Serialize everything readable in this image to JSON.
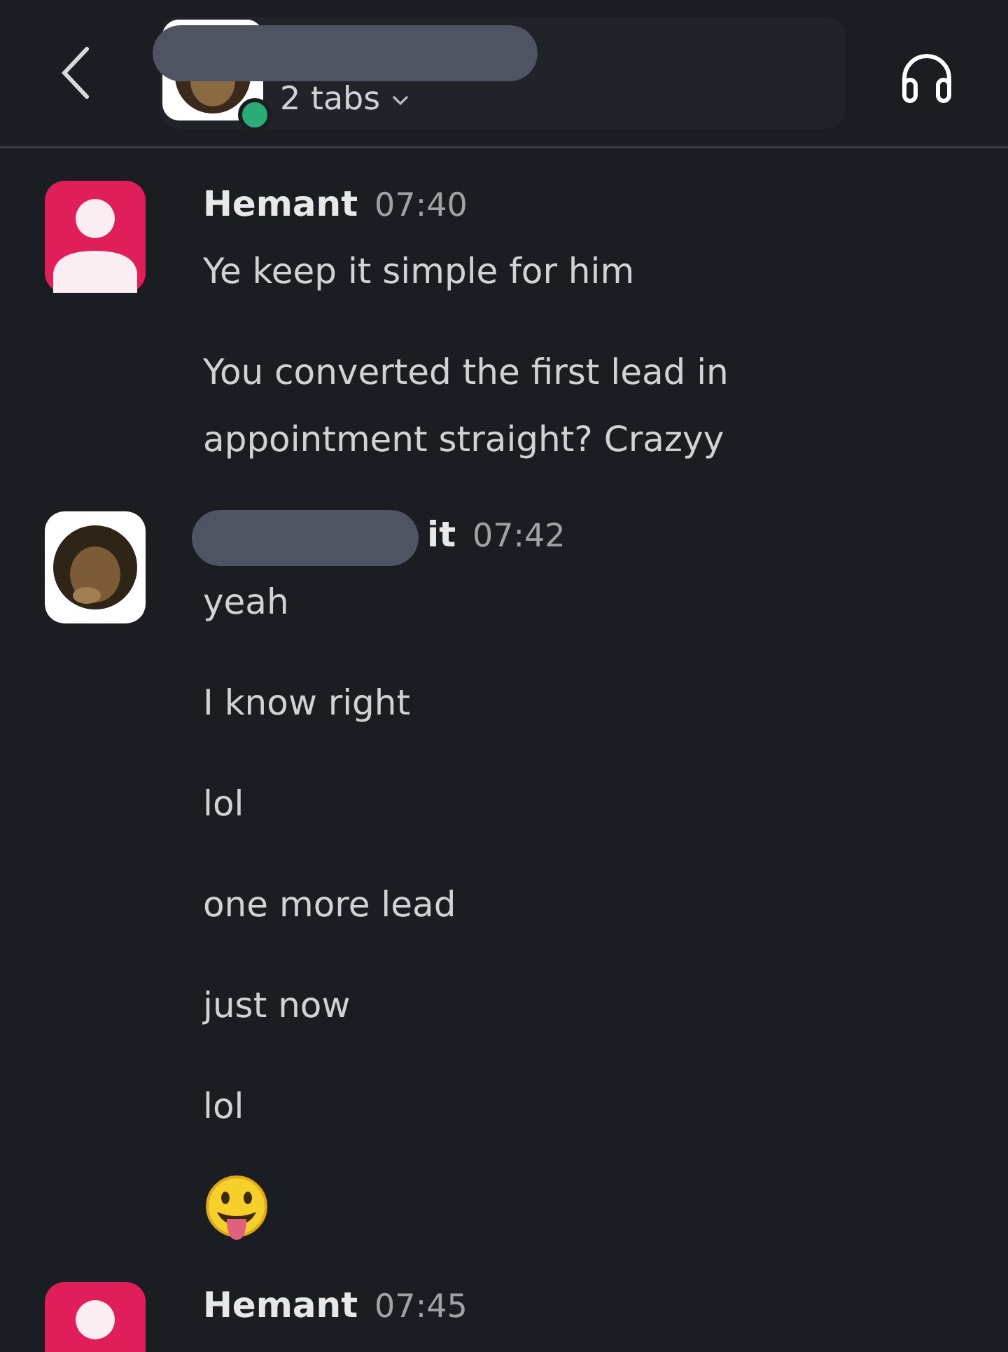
{
  "header": {
    "title_redacted": true,
    "online": true,
    "tabs_label": "2 tabs"
  },
  "messages": [
    {
      "author": "Hemant",
      "author_redacted": false,
      "time": "07:40",
      "avatar": {
        "kind": "default"
      },
      "lines": [
        {
          "kind": "text",
          "text": "Ye keep it simple for him"
        },
        {
          "kind": "text",
          "text": "You converted the first lead in appointment straight? Crazyy"
        }
      ]
    },
    {
      "author": "it",
      "author_redacted": true,
      "time": "07:42",
      "lines": [
        {
          "kind": "text",
          "text": "yeah"
        },
        {
          "kind": "text",
          "text": "I know right"
        },
        {
          "kind": "text",
          "text": "lol"
        },
        {
          "kind": "text",
          "text": "one more lead"
        },
        {
          "kind": "text",
          "text": "just now"
        },
        {
          "kind": "text",
          "text": "lol"
        },
        {
          "kind": "emoji"
        }
      ]
    },
    {
      "author": "Hemant",
      "author_redacted": false,
      "time": "07:45",
      "avatar": {
        "kind": "default"
      }
    }
  ]
}
